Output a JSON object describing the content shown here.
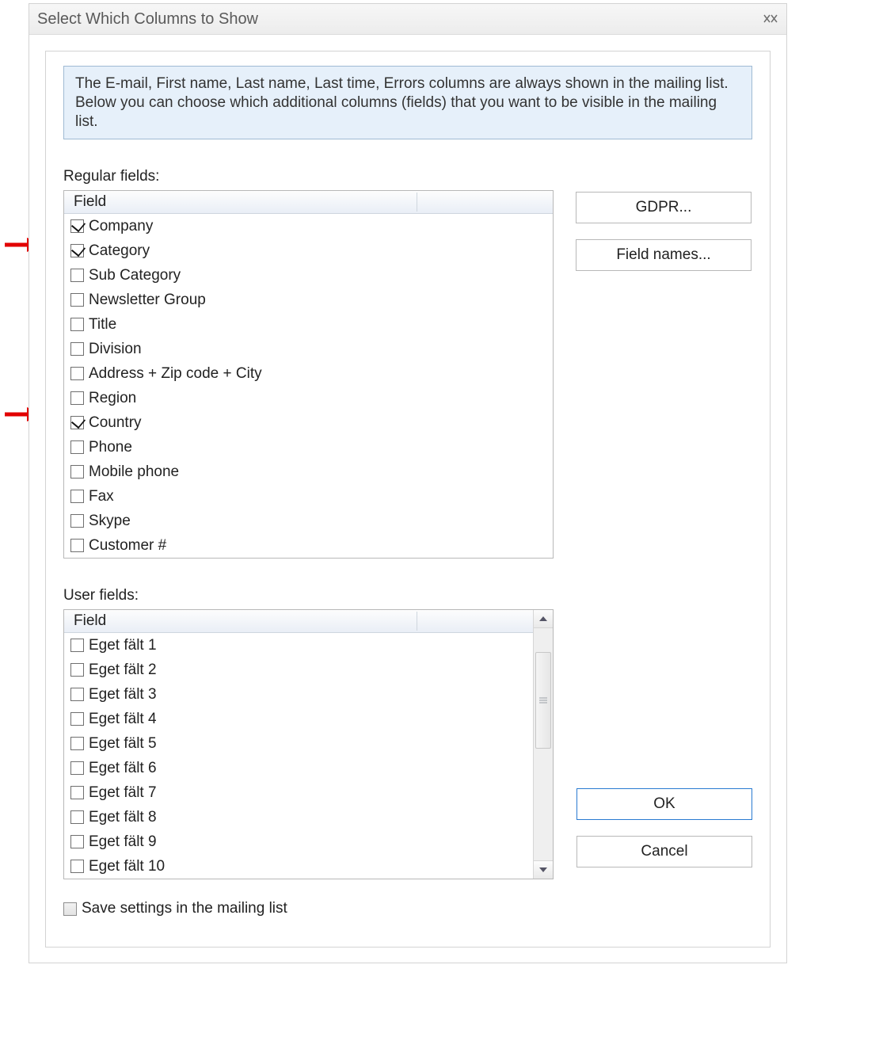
{
  "window": {
    "title": "Select Which Columns to Show"
  },
  "banner": "The E-mail, First name, Last name, Last time, Errors columns are always shown in the mailing list. Below you can choose which additional columns (fields) that you want to be visible in the mailing list.",
  "labels": {
    "regular": "Regular fields:",
    "user": "User fields:",
    "field_header_regular": "Field",
    "field_header_user": "Field",
    "save_settings": "Save settings in the mailing list"
  },
  "buttons": {
    "gdpr": "GDPR...",
    "field_names": "Field names...",
    "ok": "OK",
    "cancel": "Cancel"
  },
  "regular_fields": [
    {
      "label": "Company",
      "checked": true
    },
    {
      "label": "Category",
      "checked": true
    },
    {
      "label": "Sub Category",
      "checked": false
    },
    {
      "label": "Newsletter Group",
      "checked": false
    },
    {
      "label": "Title",
      "checked": false
    },
    {
      "label": "Division",
      "checked": false
    },
    {
      "label": "Address + Zip code + City",
      "checked": false
    },
    {
      "label": "Region",
      "checked": false
    },
    {
      "label": "Country",
      "checked": true
    },
    {
      "label": "Phone",
      "checked": false
    },
    {
      "label": "Mobile phone",
      "checked": false
    },
    {
      "label": "Fax",
      "checked": false
    },
    {
      "label": "Skype",
      "checked": false
    },
    {
      "label": "Customer #",
      "checked": false
    }
  ],
  "user_fields": [
    {
      "label": "Eget fält 1",
      "checked": false
    },
    {
      "label": "Eget fält 2",
      "checked": false
    },
    {
      "label": "Eget fält 3",
      "checked": false
    },
    {
      "label": "Eget fält 4",
      "checked": false
    },
    {
      "label": "Eget fält 5",
      "checked": false
    },
    {
      "label": "Eget fält 6",
      "checked": false
    },
    {
      "label": "Eget fält 7",
      "checked": false
    },
    {
      "label": "Eget fält 8",
      "checked": false
    },
    {
      "label": "Eget fält 9",
      "checked": false
    },
    {
      "label": "Eget fält 10",
      "checked": false
    }
  ],
  "save_settings_checked": false,
  "annotation_arrows": [
    {
      "target_field_index": 1
    },
    {
      "target_field_index": 8
    }
  ]
}
